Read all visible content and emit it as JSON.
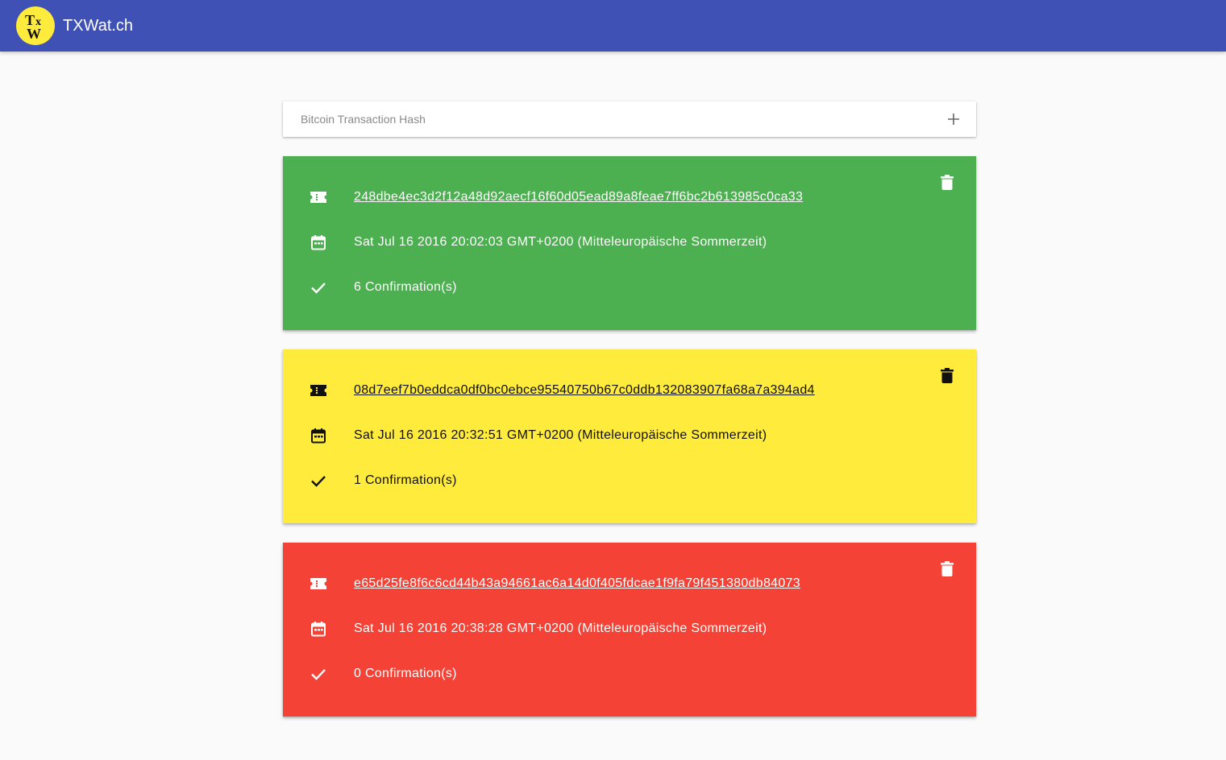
{
  "app": {
    "title": "TXWat.ch",
    "logo_text": "TxW",
    "bar_color": "#3f51b5",
    "logo_color": "#ffeb3b"
  },
  "search": {
    "placeholder": "Bitcoin Transaction Hash",
    "value": "",
    "add_icon": "plus-icon"
  },
  "transactions": [
    {
      "hash": "248dbe4ec3d2f12a48d92aecf16f60d05ead89a8feae7ff6bc2b613985c0ca33",
      "date": "Sat Jul 16 2016 20:02:03 GMT+0200 (Mitteleuropäische Sommerzeit)",
      "confirmations": "6 Confirmation(s)",
      "status_color": "#4caf50",
      "text_color": "#ffffff"
    },
    {
      "hash": "08d7eef7b0eddca0df0bc0ebce95540750b67c0ddb132083907fa68a7a394ad4",
      "date": "Sat Jul 16 2016 20:32:51 GMT+0200 (Mitteleuropäische Sommerzeit)",
      "confirmations": "1 Confirmation(s)",
      "status_color": "#ffeb3b",
      "text_color": "#111111"
    },
    {
      "hash": "e65d25fe8f6c6cd44b43a94661ac6a14d0f405fdcae1f9fa79f451380db84073",
      "date": "Sat Jul 16 2016 20:38:28 GMT+0200 (Mitteleuropäische Sommerzeit)",
      "confirmations": "0 Confirmation(s)",
      "status_color": "#f44336",
      "text_color": "#ffffff"
    }
  ]
}
